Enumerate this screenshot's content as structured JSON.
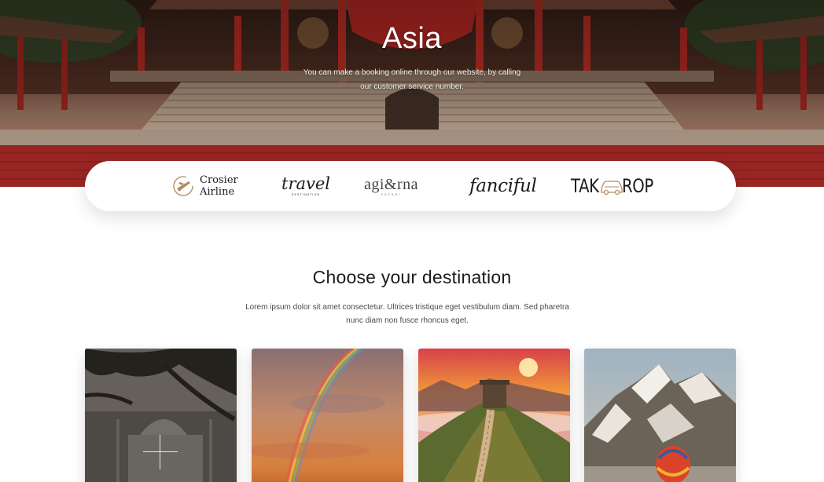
{
  "hero": {
    "title": "Asia",
    "subtitle": "You can make a booking online through our website, by calling our customer service number."
  },
  "partners": [
    {
      "name": "Crosier Airline",
      "line1": "Crosier",
      "line2": "Airline",
      "icon": "airplane-circle-icon"
    },
    {
      "name": "travel",
      "text": "travel",
      "tagline": "DESTINATION"
    },
    {
      "name": "agirna",
      "text": "agi&rna",
      "tagline": "SAFARI"
    },
    {
      "name": "fanciful",
      "text": "fanciful"
    },
    {
      "name": "TAKROP",
      "left": "TAK",
      "right": "ROP",
      "icon": "car-icon"
    }
  ],
  "section": {
    "title": "Choose your destination",
    "description": "Lorem ipsum dolor sit amet consectetur. Ultrices tristique eget vestibulum diam. Sed pharetra nunc diam non fusce rhoncus eget."
  },
  "cards": [
    {
      "id": "taj-mahal",
      "icon": "plus-icon"
    },
    {
      "id": "rainbow-sunset"
    },
    {
      "id": "great-wall"
    },
    {
      "id": "mountains-balloon"
    }
  ],
  "colors": {
    "hero_red": "#9c2a27",
    "text_dark": "#1b1b1b",
    "text_muted": "#4a4a4a",
    "logo_gold": "#b08a5a"
  }
}
